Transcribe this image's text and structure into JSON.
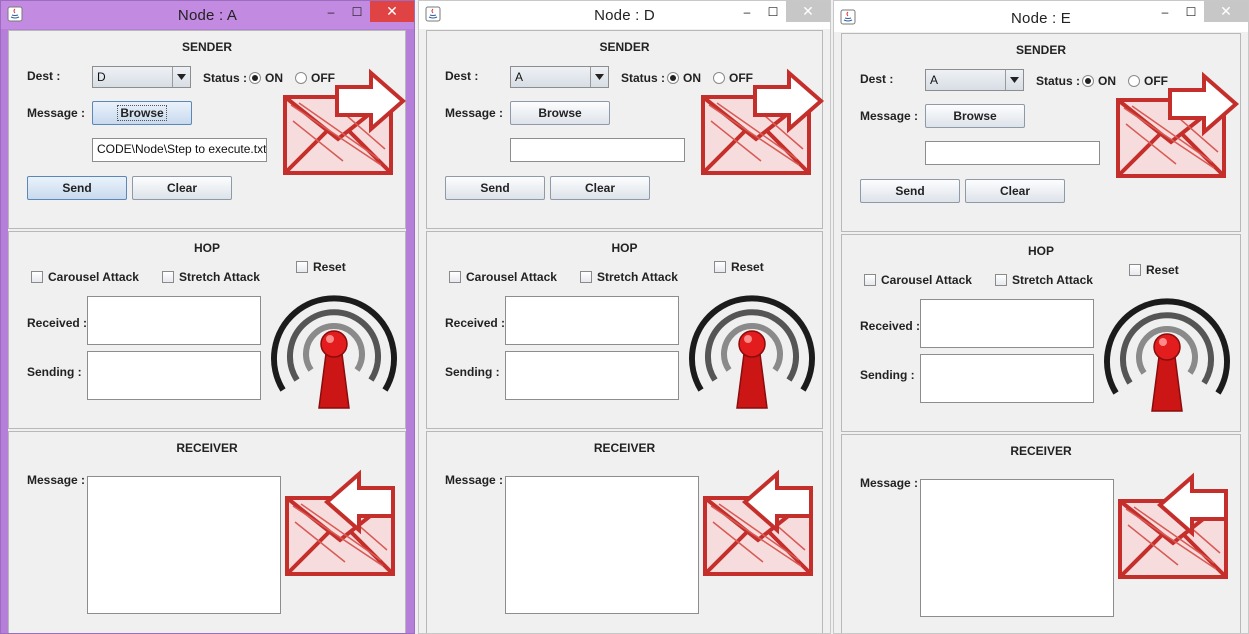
{
  "colors": {
    "active_titlebar": "#c28ae0",
    "inactive_titlebar": "#ffffff",
    "close_active": "#e04343",
    "mail_red": "#d43a36",
    "tower_red": "#d41818"
  },
  "windows": [
    {
      "id": "a",
      "title": "Node : A",
      "controls": {
        "minimize": "–",
        "maximize": "☐",
        "close": "✕"
      },
      "sender": {
        "title": "SENDER",
        "dest_label": "Dest :",
        "dest_value": "D",
        "status_label": "Status :",
        "status_on": "ON",
        "status_off": "OFF",
        "status_selected": "ON",
        "message_label": "Message :",
        "browse_label": "Browse",
        "path_value": "CODE\\Node\\Step to execute.txt",
        "send_label": "Send",
        "clear_label": "Clear"
      },
      "hop": {
        "title": "HOP",
        "carousel_label": "Carousel Attack",
        "stretch_label": "Stretch Attack",
        "reset_label": "Reset",
        "received_label": "Received :",
        "sending_label": "Sending :"
      },
      "receiver": {
        "title": "RECEIVER",
        "message_label": "Message :"
      }
    },
    {
      "id": "d",
      "title": "Node : D",
      "controls": {
        "minimize": "–",
        "maximize": "☐",
        "close": "✕"
      },
      "sender": {
        "title": "SENDER",
        "dest_label": "Dest :",
        "dest_value": "A",
        "status_label": "Status :",
        "status_on": "ON",
        "status_off": "OFF",
        "status_selected": "ON",
        "message_label": "Message :",
        "browse_label": "Browse",
        "path_value": "",
        "send_label": "Send",
        "clear_label": "Clear"
      },
      "hop": {
        "title": "HOP",
        "carousel_label": "Carousel Attack",
        "stretch_label": "Stretch Attack",
        "reset_label": "Reset",
        "received_label": "Received :",
        "sending_label": "Sending :"
      },
      "receiver": {
        "title": "RECEIVER",
        "message_label": "Message :"
      }
    },
    {
      "id": "e",
      "title": "Node : E",
      "controls": {
        "minimize": "–",
        "maximize": "☐",
        "close": "✕"
      },
      "sender": {
        "title": "SENDER",
        "dest_label": "Dest :",
        "dest_value": "A",
        "status_label": "Status :",
        "status_on": "ON",
        "status_off": "OFF",
        "status_selected": "ON",
        "message_label": "Message :",
        "browse_label": "Browse",
        "path_value": "",
        "send_label": "Send",
        "clear_label": "Clear"
      },
      "hop": {
        "title": "HOP",
        "carousel_label": "Carousel Attack",
        "stretch_label": "Stretch Attack",
        "reset_label": "Reset",
        "received_label": "Received :",
        "sending_label": "Sending :"
      },
      "receiver": {
        "title": "RECEIVER",
        "message_label": "Message :"
      }
    }
  ]
}
